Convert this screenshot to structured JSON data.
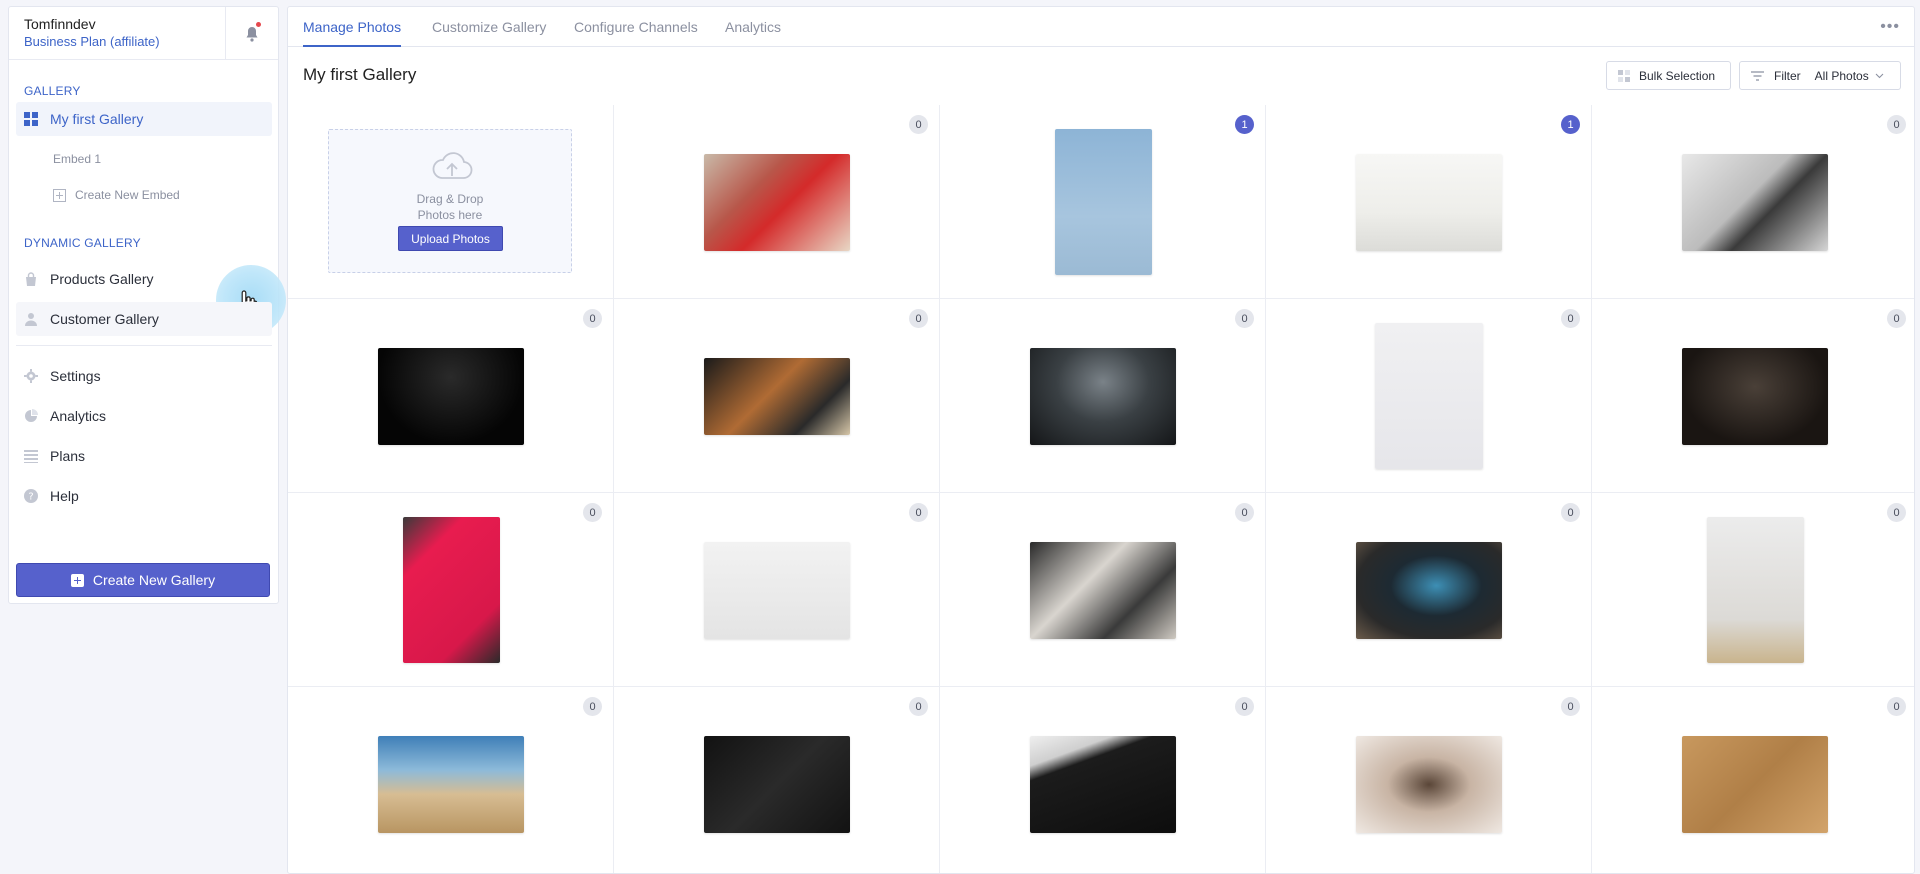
{
  "account": {
    "name": "Tomfinndev",
    "plan": "Business Plan (affiliate)"
  },
  "sidebar": {
    "gallery_section": "GALLERY",
    "gallery_item": "My first Gallery",
    "embed_item": "Embed 1",
    "create_embed": "Create New Embed",
    "dynamic_section": "DYNAMIC GALLERY",
    "products": "Products Gallery",
    "customer": "Customer Gallery",
    "settings": "Settings",
    "analytics": "Analytics",
    "plans": "Plans",
    "help": "Help",
    "create_gallery": "Create New Gallery"
  },
  "tabs": [
    "Manage Photos",
    "Customize Gallery",
    "Configure Channels",
    "Analytics"
  ],
  "page": {
    "title": "My first Gallery",
    "bulk": "Bulk Selection",
    "filter": "Filter",
    "filter_value": "All Photos"
  },
  "upload": {
    "line1": "Drag & Drop",
    "line2": "Photos here",
    "button": "Upload Photos"
  },
  "photos": [
    {
      "count": "0",
      "subject": "donut-cups"
    },
    {
      "count": "1",
      "subject": "stool"
    },
    {
      "count": "1",
      "subject": "plant"
    },
    {
      "count": "0",
      "subject": "headphones-bed"
    },
    {
      "count": "0",
      "subject": "game-controller"
    },
    {
      "count": "0",
      "subject": "watch-stack"
    },
    {
      "count": "0",
      "subject": "smartwatch"
    },
    {
      "count": "0",
      "subject": "earbuds"
    },
    {
      "count": "0",
      "subject": "sneaker-dark"
    },
    {
      "count": "0",
      "subject": "red-phone"
    },
    {
      "count": "0",
      "subject": "sneaker-white"
    },
    {
      "count": "0",
      "subject": "backpack"
    },
    {
      "count": "0",
      "subject": "wristwatch"
    },
    {
      "count": "0",
      "subject": "product-box"
    },
    {
      "count": "0",
      "subject": "beach-sunglasses"
    },
    {
      "count": "0",
      "subject": "desk-flatlay"
    },
    {
      "count": "0",
      "subject": "earphones-keyboard"
    },
    {
      "count": "0",
      "subject": "headphones-hand"
    },
    {
      "count": "0",
      "subject": "converse"
    }
  ],
  "colors": {
    "accent": "#5661cc",
    "link": "#3d64c8"
  }
}
